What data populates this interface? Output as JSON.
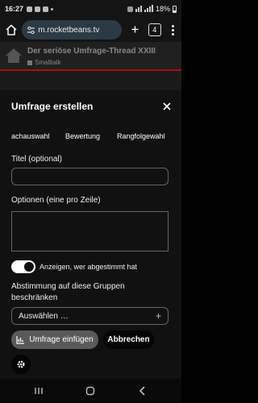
{
  "status_bar": {
    "time": "16:27",
    "battery": "18%"
  },
  "browser": {
    "url": "m.rocketbeans.tv",
    "tab_count": "4"
  },
  "page": {
    "thread_title": "Der seriöse Umfrage-Thread XXIII",
    "category": "Smalltalk"
  },
  "modal": {
    "title": "Umfrage erstellen",
    "type_tabs": [
      "achauswahl",
      "Bewertung",
      "Rangfolgewahl"
    ],
    "title_label": "Titel (optional)",
    "title_value": "",
    "options_label": "Optionen (eine pro Zeile)",
    "options_value": "",
    "voters_toggle_on": true,
    "voters_toggle_label": "Anzeigen, wer abgestimmt hat",
    "group_label": "Abstimmung auf diese Gruppen beschränken",
    "group_select_placeholder": "Auswählen …",
    "insert_button": "Umfrage einfügen",
    "cancel_button": "Abbrechen"
  },
  "colors": {
    "accent": "#b00b0b",
    "url_bar": "#2b3a45",
    "modal_bg": "#111111"
  },
  "icons": [
    "home-icon",
    "tune-icon",
    "plus-icon",
    "tabs-icon",
    "more-vert-icon",
    "close-icon",
    "chart-icon",
    "gear-icon",
    "recent-apps-icon",
    "nav-home-icon",
    "back-icon"
  ]
}
